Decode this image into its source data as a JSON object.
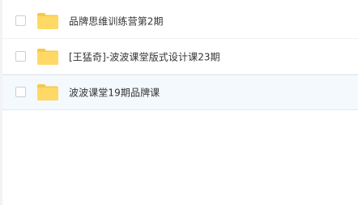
{
  "files": [
    {
      "name": "品牌思维训练营第2期",
      "icon": "folder-icon",
      "checked": false
    },
    {
      "name": "[王猛奇]-波波课堂版式设计课23期",
      "icon": "folder-icon",
      "checked": false
    },
    {
      "name": "波波课堂19期品牌课",
      "icon": "folder-icon",
      "checked": false
    }
  ],
  "colors": {
    "folder": "#ffd866",
    "folder_tab": "#f7c94a",
    "hover_row": "#f4f9fd"
  }
}
